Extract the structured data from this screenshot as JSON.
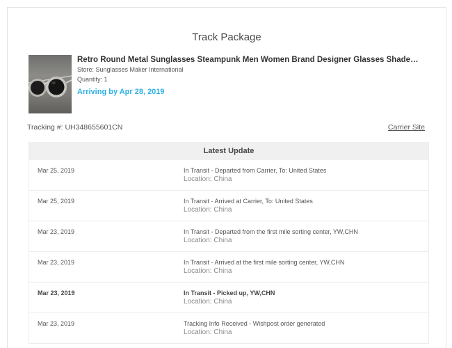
{
  "page": {
    "title": "Track Package"
  },
  "product": {
    "image_icon": "sunglasses-photo",
    "title": "Retro Round Metal Sunglasses Steampunk Men Women Brand Designer Glasses Shade…",
    "store": "Store: Sunglasses Maker International",
    "quantity": "Quantity: 1",
    "arriving": "Arriving by Apr 28, 2019"
  },
  "tracking": {
    "number": "Tracking #: UH348655601CN",
    "carrier_link": "Carrier Site"
  },
  "updates": {
    "header": "Latest Update",
    "rows": [
      {
        "date": "Mar 25, 2019",
        "status": "In Transit - Departed from Carrier, To: United States",
        "location": "Location: China",
        "bold": false
      },
      {
        "date": "Mar 25, 2019",
        "status": "In Transit - Arrived at Carrier, To: United States",
        "location": "Location: China",
        "bold": false
      },
      {
        "date": "Mar 23, 2019",
        "status": "In Transit - Departed from the first mile sorting center, YW,CHN",
        "location": "Location: China",
        "bold": false
      },
      {
        "date": "Mar 23, 2019",
        "status": "In Transit - Arrived at the first mile sorting center, YW,CHN",
        "location": "Location: China",
        "bold": false
      },
      {
        "date": "Mar 23, 2019",
        "status": "In Transit - Picked up, YW,CHN",
        "location": "Location: China",
        "bold": true
      },
      {
        "date": "Mar 23, 2019",
        "status": "Tracking Info Received - Wishpost order generated",
        "location": "Location: China",
        "bold": false
      }
    ]
  },
  "colors": {
    "accent": "#2fb1e4",
    "header_bg": "#f0f0f0",
    "border": "#e2e2e2"
  }
}
